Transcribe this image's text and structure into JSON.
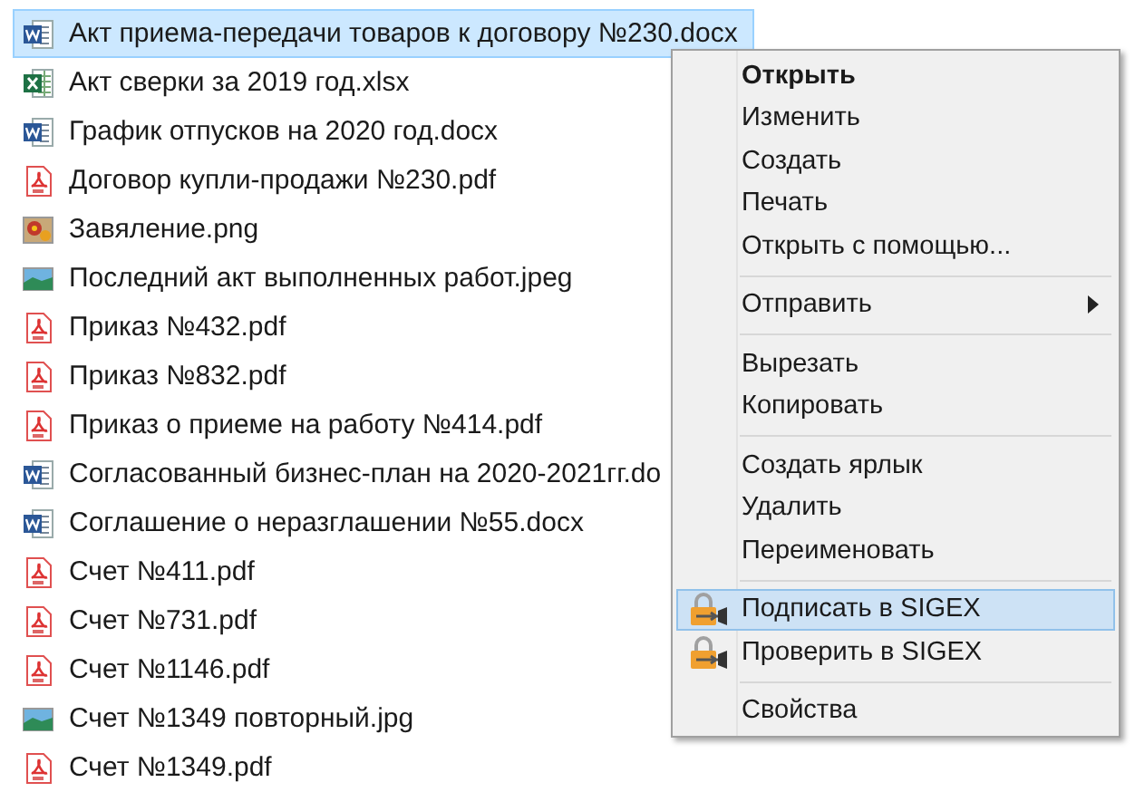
{
  "files": [
    {
      "name": "Акт приема-передачи товаров к договору №230.docx",
      "kind": "word",
      "selected": true
    },
    {
      "name": "Акт сверки за 2019 год.xlsx",
      "kind": "excel",
      "selected": false
    },
    {
      "name": "График отпусков на 2020 год.docx",
      "kind": "word",
      "selected": false
    },
    {
      "name": "Договор купли-продажи №230.pdf",
      "kind": "pdf",
      "selected": false
    },
    {
      "name": "Завяление.png",
      "kind": "picture",
      "selected": false
    },
    {
      "name": "Последний акт выполненных работ.jpeg",
      "kind": "landscape",
      "selected": false
    },
    {
      "name": "Приказ №432.pdf",
      "kind": "pdf",
      "selected": false
    },
    {
      "name": "Приказ №832.pdf",
      "kind": "pdf",
      "selected": false
    },
    {
      "name": "Приказ о приеме на работу №414.pdf",
      "kind": "pdf",
      "selected": false
    },
    {
      "name": "Согласованный бизнес-план на 2020-2021гг.do",
      "kind": "word",
      "selected": false
    },
    {
      "name": "Соглашение о неразглашении №55.docx",
      "kind": "word",
      "selected": false
    },
    {
      "name": "Счет №411.pdf",
      "kind": "pdf",
      "selected": false
    },
    {
      "name": "Счет №731.pdf",
      "kind": "pdf",
      "selected": false
    },
    {
      "name": "Счет №1146.pdf",
      "kind": "pdf",
      "selected": false
    },
    {
      "name": "Счет №1349 повторный.jpg",
      "kind": "landscape",
      "selected": false
    },
    {
      "name": "Счет №1349.pdf",
      "kind": "pdf",
      "selected": false
    }
  ],
  "context_menu": [
    {
      "kind": "item",
      "label": "Открыть",
      "default": true,
      "selected": false
    },
    {
      "kind": "item",
      "label": "Изменить",
      "default": false,
      "selected": false
    },
    {
      "kind": "item",
      "label": "Создать",
      "default": false,
      "selected": false
    },
    {
      "kind": "item",
      "label": "Печать",
      "default": false,
      "selected": false
    },
    {
      "kind": "item",
      "label": "Открыть с помощью...",
      "default": false,
      "selected": false
    },
    {
      "kind": "separator"
    },
    {
      "kind": "submenu",
      "label": "Отправить",
      "default": false,
      "selected": false
    },
    {
      "kind": "separator"
    },
    {
      "kind": "item",
      "label": "Вырезать",
      "default": false,
      "selected": false
    },
    {
      "kind": "item",
      "label": "Копировать",
      "default": false,
      "selected": false
    },
    {
      "kind": "separator"
    },
    {
      "kind": "item",
      "label": "Создать ярлык",
      "default": false,
      "selected": false
    },
    {
      "kind": "item",
      "label": "Удалить",
      "default": false,
      "selected": false
    },
    {
      "kind": "item",
      "label": "Переименовать",
      "default": false,
      "selected": false
    },
    {
      "kind": "separator"
    },
    {
      "kind": "sigex",
      "label": "Подписать в SIGEX",
      "default": false,
      "selected": true
    },
    {
      "kind": "sigex",
      "label": "Проверить в SIGEX",
      "default": false,
      "selected": false
    },
    {
      "kind": "separator"
    },
    {
      "kind": "item",
      "label": "Свойства",
      "default": false,
      "selected": false
    }
  ]
}
